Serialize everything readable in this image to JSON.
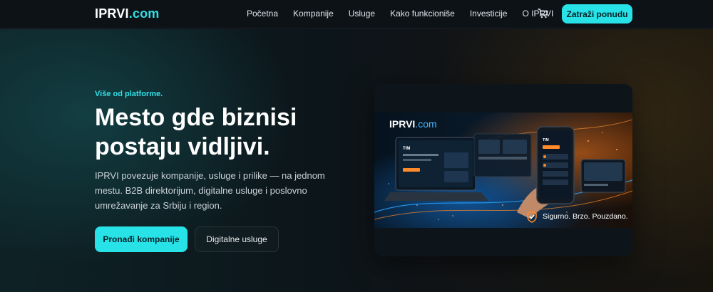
{
  "header": {
    "logo_main": "IPRVI",
    "logo_suffix": ".com",
    "nav": [
      "Početna",
      "Kompanije",
      "Usluge",
      "Kako funkcioniše",
      "Investicije",
      "O IPRVI"
    ],
    "cta": "Zatraži ponudu"
  },
  "hero": {
    "eyebrow": "Više od platforme.",
    "headline": "Mesto gde biznisi postaju vidljivi.",
    "description": "IPRVI povezuje kompanije, usluge i prilike — na jednom mestu. B2B direktorijum, digitalne usluge i poslovno umrežavanje za Srbiju i region.",
    "primary_button": "Pronađi kompanije",
    "secondary_button": "Digitalne usluge"
  },
  "showcase": {
    "brand_main": "IPRVI",
    "brand_suffix": ".com",
    "tagline": "Sigurno. Brzo. Pouzdano.",
    "screen_label": "TIM"
  },
  "colors": {
    "accent": "#27e3e8",
    "background": "#0b1014"
  }
}
